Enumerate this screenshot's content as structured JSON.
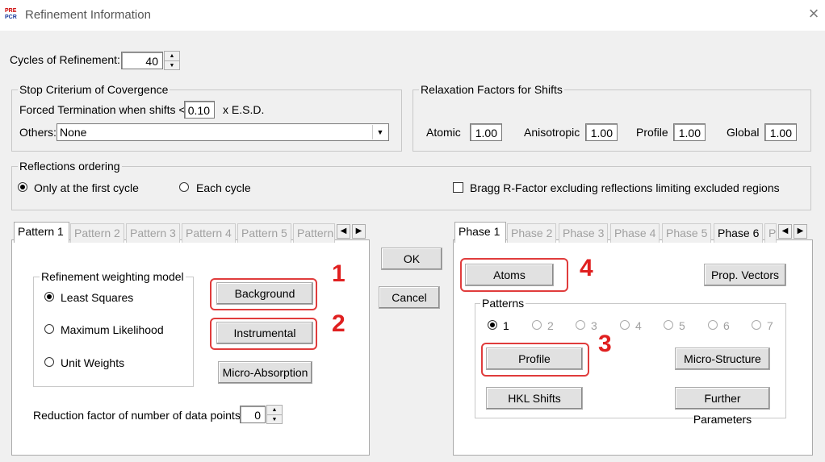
{
  "window": {
    "title": "Refinement Information",
    "app_icon_top": "PRE",
    "app_icon_bottom": "PCR",
    "close_icon": "×"
  },
  "cycles": {
    "label": "Cycles of Refinement:",
    "value": "40"
  },
  "stop": {
    "title": "Stop Criterium of Covergence",
    "forced_label": "Forced Termination when  shifts <",
    "forced_value": "0.10",
    "forced_suffix": "x  E.S.D.",
    "others_label": "Others:",
    "others_value": "None"
  },
  "relax": {
    "title": "Relaxation Factors for Shifts",
    "atomic_label": "Atomic",
    "atomic_value": "1.00",
    "aniso_label": "Anisotropic",
    "aniso_value": "1.00",
    "profile_label": "Profile",
    "profile_value": "1.00",
    "global_label": "Global",
    "global_value": "1.00"
  },
  "reflections": {
    "title": "Reflections ordering",
    "first": "Only at the first cycle",
    "each": "Each cycle",
    "bragg": "Bragg R-Factor excluding  reflections limiting excluded regions"
  },
  "pattern_tabs": [
    "Pattern 1",
    "Pattern 2",
    "Pattern 3",
    "Pattern 4",
    "Pattern 5",
    "Pattern"
  ],
  "weighting": {
    "title": "Refinement weighting model",
    "ls": "Least Squares",
    "ml": "Maximum Likelihood",
    "uw": "Unit Weights"
  },
  "pattern_buttons": {
    "background": "Background",
    "instrumental": "Instrumental",
    "micro_absorption": "Micro-Absorption"
  },
  "reduction": {
    "label": "Reduction factor of number of data points:",
    "value": "0"
  },
  "center": {
    "ok": "OK",
    "cancel": "Cancel"
  },
  "phase_tabs": [
    "Phase 1",
    "Phase 2",
    "Phase 3",
    "Phase 4",
    "Phase 5",
    "Phase 6",
    "P"
  ],
  "phase_buttons": {
    "atoms": "Atoms",
    "prop_vectors": "Prop. Vectors",
    "profile": "Profile",
    "micro_structure": "Micro-Structure",
    "hkl_shifts": "HKL Shifts",
    "further": "Further Parameters"
  },
  "patterns": {
    "title": "Patterns",
    "options": [
      "1",
      "2",
      "3",
      "4",
      "5",
      "6",
      "7"
    ]
  },
  "annotations": [
    "1",
    "2",
    "3",
    "4"
  ],
  "icons": {
    "arrow_left": "◀",
    "arrow_right": "▶",
    "spin_up": "▲",
    "spin_down": "▼",
    "dropdown": "▼"
  }
}
